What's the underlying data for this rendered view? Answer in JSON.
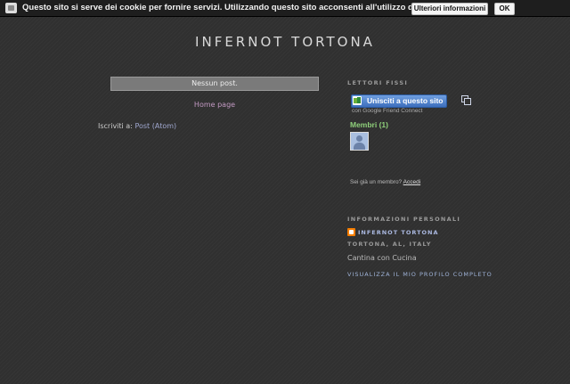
{
  "cookie_bar": {
    "text": "Questo sito si serve dei cookie per fornire servizi. Utilizzando questo sito acconsenti all'utilizzo dei cookie.",
    "more_info_label": "Ulteriori informazioni",
    "ok_label": "OK"
  },
  "blog": {
    "title": "INFERNOT TORTONA"
  },
  "main": {
    "no_posts": "Nessun post.",
    "home_link": "Home page",
    "subscribe_prefix": "Iscriviti a:",
    "subscribe_link": "Post (Atom)"
  },
  "followers": {
    "heading": "LETTORI FISSI",
    "join_label": "Unisciti a questo sito",
    "gfc_caption": "con Google Friend Connect",
    "members_label": "Membri (1)",
    "signin_prefix": "Sei già un membro?",
    "signin_link": "Accedi"
  },
  "profile": {
    "heading": "INFORMAZIONI PERSONALI",
    "name": "INFERNOT TORTONA",
    "location": "TORTONA, AL, ITALY",
    "description": "Cantina con Cucina",
    "full_profile_link": "VISUALIZZA IL MIO PROFILO COMPLETO"
  }
}
